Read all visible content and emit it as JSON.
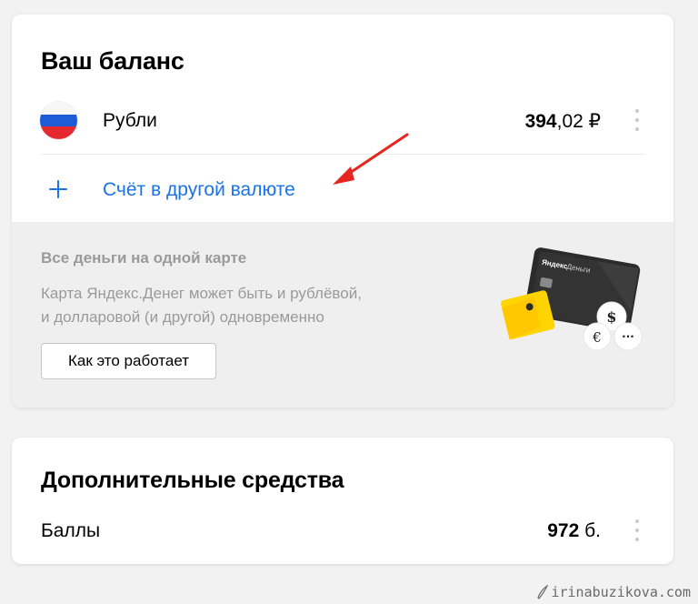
{
  "balance": {
    "title": "Ваш баланс",
    "rub": {
      "label": "Рубли",
      "amount_int": "394",
      "amount_dec": ",02 ₽",
      "flag_icon": "russia-flag-icon"
    },
    "add_currency": {
      "icon": "plus-icon",
      "label": "Счёт в другой валюте"
    },
    "promo": {
      "title": "Все деньги на одной карте",
      "text_line1": "Карта Яндекс.Денег может быть и рублёвой,",
      "text_line2": "и долларовой (и другой) одновременно",
      "button_label": "Как это работает",
      "card_brand": "Яндекс",
      "card_brand_sub": "Деньги",
      "coin_dollar": "$",
      "coin_euro": "€",
      "coin_more": "···"
    }
  },
  "extra": {
    "title": "Дополнительные средства",
    "points": {
      "label": "Баллы",
      "amount_int": "972",
      "amount_unit": " б."
    }
  },
  "watermark": "irinabuzikova.com",
  "colors": {
    "background": "#f2f2f2",
    "link": "#1a73e8",
    "arrow": "#e5261f",
    "promo_bg": "#efefef",
    "muted_text": "#9a9a9a",
    "card_yellow": "#ffd400"
  }
}
